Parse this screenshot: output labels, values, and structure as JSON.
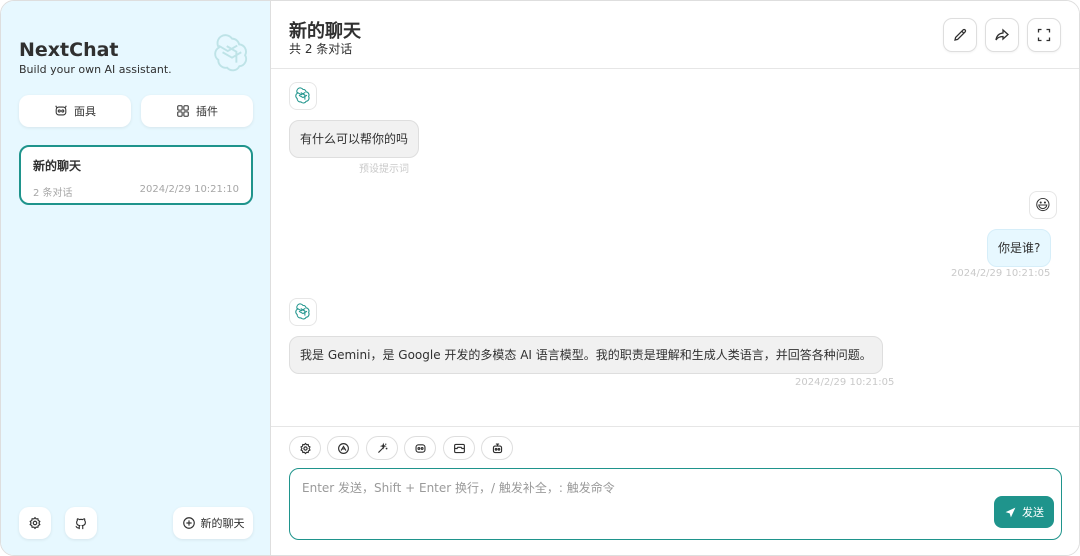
{
  "sidebar": {
    "brand_title": "NextChat",
    "brand_subtitle": "Build your own AI assistant.",
    "logo_icon": "openai-logo-icon",
    "mask_button": "面具",
    "plugin_button": "插件",
    "chats": [
      {
        "title": "新的聊天",
        "count": "2 条对话",
        "time": "2024/2/29 10:21:10"
      }
    ],
    "new_chat_button": "新的聊天",
    "settings_icon": "gear-icon",
    "github_icon": "github-icon"
  },
  "header": {
    "title": "新的聊天",
    "subtitle": "共 2 条对话",
    "edit_icon": "pencil-icon",
    "share_icon": "share-icon",
    "fullscreen_icon": "fullscreen-icon"
  },
  "messages": [
    {
      "role": "bot",
      "text": "有什么可以帮你的吗",
      "meta": "预设提示词"
    },
    {
      "role": "user",
      "avatar": "😃",
      "text": "你是谁?",
      "meta": "2024/2/29 10:21:05"
    },
    {
      "role": "bot",
      "text": "我是 Gemini，是 Google 开发的多模态 AI 语言模型。我的职责是理解和生成人类语言，并回答各种问题。",
      "meta": "2024/2/29 10:21:05"
    }
  ],
  "input": {
    "placeholder": "Enter 发送，Shift + Enter 换行，/ 触发补全，: 触发命令",
    "send_label": "发送",
    "tools": [
      "settings-icon",
      "theme-icon",
      "prompt-icon",
      "mask-icon",
      "clear-icon",
      "robot-icon"
    ]
  },
  "colors": {
    "accent": "#1f948c",
    "sidebar_bg": "#e7f8ff",
    "bot_bubble": "#f1f1f1",
    "user_bubble": "#e7f8ff"
  }
}
